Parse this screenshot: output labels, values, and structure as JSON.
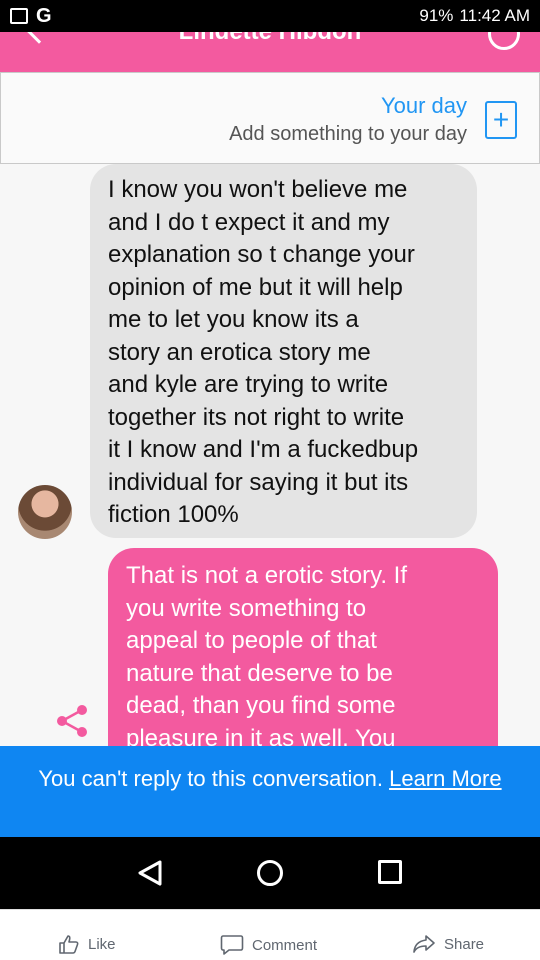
{
  "status_bar": {
    "battery": "91%",
    "time": "11:42 AM",
    "left_icons": [
      "gallery-icon",
      "google-icon"
    ]
  },
  "header": {
    "title": "Lindette Hibdon"
  },
  "your_day": {
    "title": "Your day",
    "subtitle": "Add something to your day",
    "add_label": "+"
  },
  "messages": {
    "incoming": [
      "I know you won't believe me",
      "and I do t expect it and my",
      "explanation so t change your",
      "opinion of me but it will help",
      "me to let you know its a",
      "story an erotica story me",
      "and kyle are trying to write",
      "together its not right to write",
      "it I know and I'm a fuckedbup",
      "individual for saying it but its",
      "fiction 100%"
    ],
    "outgoing": [
      "That is not a erotic story. If",
      "you write something to",
      "appeal to people of that",
      "nature that deserve to be",
      "dead, than you find some",
      "pleasure in it as well. You"
    ]
  },
  "notice": {
    "text": "You can't reply to this conversation.",
    "link": "Learn More"
  },
  "fb_actions": {
    "like": "Like",
    "comment": "Comment",
    "share": "Share"
  },
  "colors": {
    "accent_pink": "#f35a9f",
    "notice_blue": "#0f86f2",
    "link_blue": "#2196f3"
  }
}
